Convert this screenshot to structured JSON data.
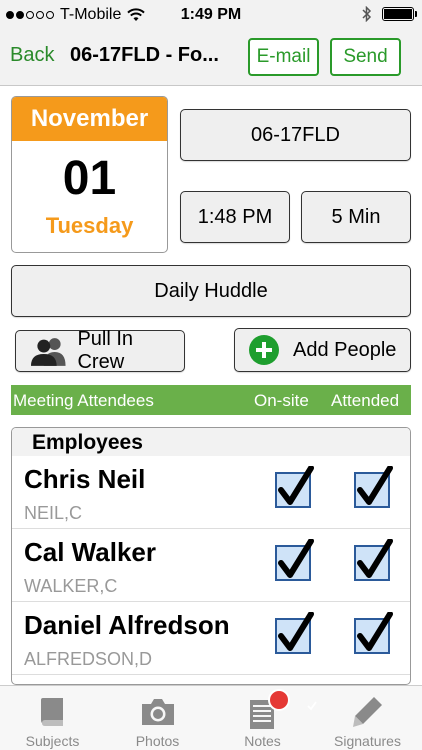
{
  "status_bar": {
    "carrier": "T-Mobile",
    "time": "1:49 PM"
  },
  "nav": {
    "back_label": "Back",
    "title": "06-17FLD - Fo...",
    "email_label": "E-mail",
    "send_label": "Send"
  },
  "calendar": {
    "month": "November",
    "day": "01",
    "weekday": "Tuesday"
  },
  "meeting": {
    "project": "06-17FLD",
    "time": "1:48 PM",
    "duration": "5 Min",
    "type": "Daily Huddle"
  },
  "actions": {
    "pull_in_crew": "Pull In Crew",
    "add_people": "Add People"
  },
  "attendees_header": {
    "title": "Meeting Attendees",
    "onsite": "On-site",
    "attended": "Attended"
  },
  "employees": {
    "section_title": "Employees",
    "rows": [
      {
        "name": "Chris Neil",
        "code": "NEIL,C",
        "onsite": true,
        "attended": true
      },
      {
        "name": "Cal Walker",
        "code": "WALKER,C",
        "onsite": true,
        "attended": true
      },
      {
        "name": "Daniel Alfredson",
        "code": "ALFREDSON,D",
        "onsite": true,
        "attended": true
      }
    ]
  },
  "tabs": [
    {
      "label": "Subjects",
      "icon": "book-icon"
    },
    {
      "label": "Photos",
      "icon": "camera-icon"
    },
    {
      "label": "Notes",
      "icon": "notepad-icon"
    },
    {
      "label": "Signatures",
      "icon": "pencil-icon"
    }
  ],
  "colors": {
    "accent_green": "#2a9a2a",
    "calendar_orange": "#f59a1b",
    "header_green": "#6ab04a",
    "badge_red": "#e53935"
  }
}
